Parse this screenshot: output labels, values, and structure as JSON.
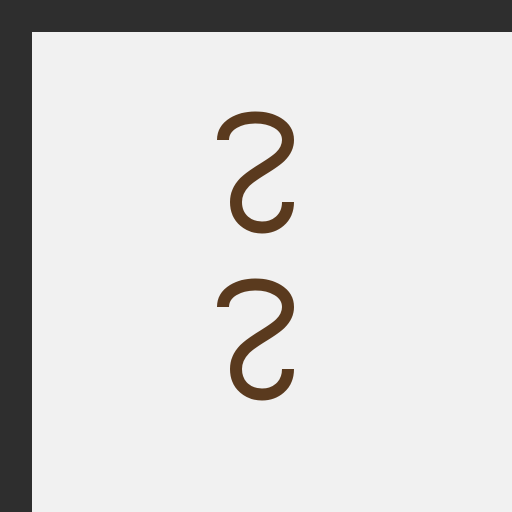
{
  "colors": {
    "frame": "#2e2e2e",
    "canvas": "#f1f1f1",
    "icon": "#5a3a1e"
  },
  "icons": [
    {
      "name": "s-hook-icon"
    },
    {
      "name": "s-hook-icon"
    }
  ]
}
